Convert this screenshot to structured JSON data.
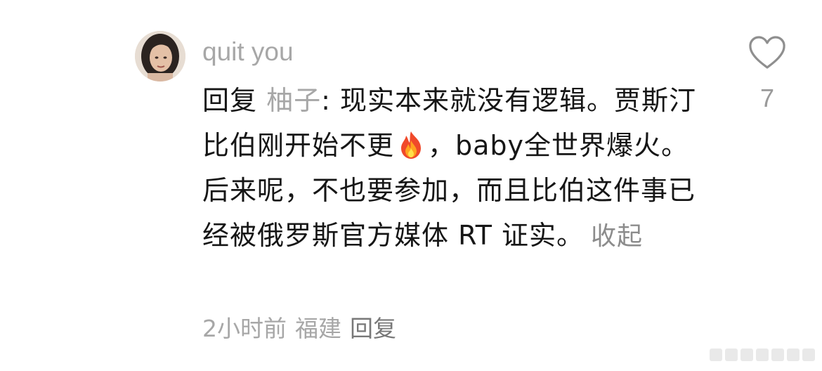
{
  "comment": {
    "username": "quit you",
    "reply_prefix": "回复 ",
    "reply_to": "柚子",
    "text_part1": ": 现实本来就没有逻辑。贾斯汀比伯刚开始不更",
    "emoji": "fire-icon",
    "text_part2": "，baby全世界爆火。后来呢，不也要参加，而且比伯这件事已经被俄罗斯官方媒体 RT 证实。",
    "collapse_label": "收起",
    "meta": {
      "time": "2小时前",
      "location": "福建",
      "reply_label": "回复"
    },
    "likes": "7"
  },
  "colors": {
    "name_gray": "#a7a7a7",
    "text_dark": "#161616",
    "heart_stroke": "#8f8f8f"
  }
}
